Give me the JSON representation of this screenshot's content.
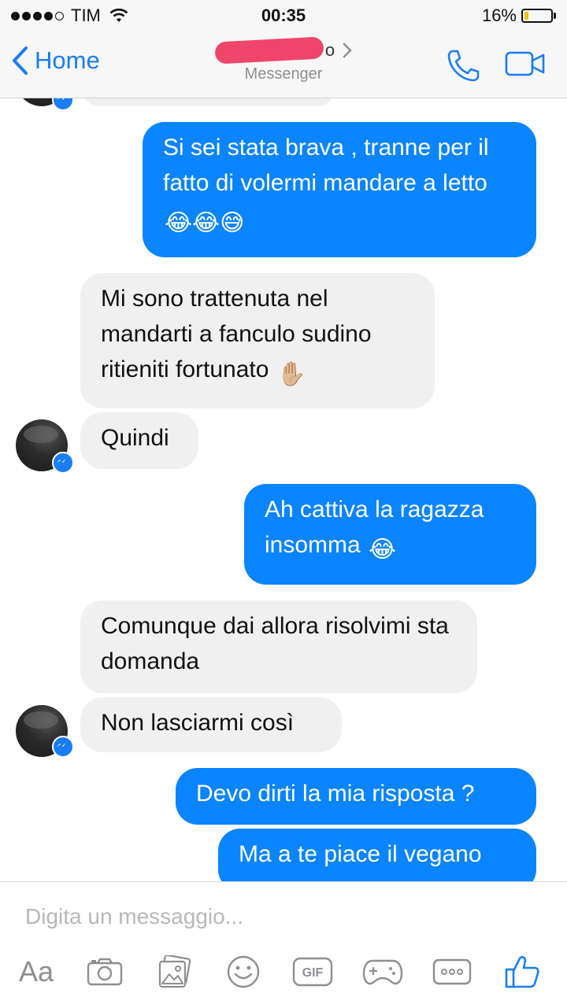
{
  "status_bar": {
    "carrier": "TIM",
    "time": "00:35",
    "battery_percent_text": "16%",
    "battery_level": 0.16
  },
  "nav": {
    "back_label": "Home",
    "contact_name_visible": "o",
    "subtitle": "Messenger"
  },
  "messages": [
    {
      "direction": "out",
      "text": "Si sei stata brava , tranne per il fatto di volermi mandare a letto",
      "emoji": "😂😂😅"
    },
    {
      "direction": "in",
      "text": "Mi sono trattenuta nel mandarti a fanculo sudino ritieniti fortunato",
      "emoji": "✋🏼"
    },
    {
      "direction": "in",
      "text": "Quindi",
      "emoji": ""
    },
    {
      "direction": "out",
      "text": "Ah cattiva la ragazza insomma",
      "emoji": "😂"
    },
    {
      "direction": "in",
      "text": "Comunque dai allora risolvimi sta domanda",
      "emoji": ""
    },
    {
      "direction": "in",
      "text": "Non lasciarmi così",
      "emoji": ""
    },
    {
      "direction": "out",
      "text": "Devo dirti la mia risposta ?",
      "emoji": ""
    },
    {
      "direction": "out",
      "text": "Ma a te piace il vegano",
      "emoji": ""
    }
  ],
  "composer": {
    "placeholder": "Digita un messaggio...",
    "aa_label": "Aa",
    "gif_label": "GIF",
    "tools": [
      "text-format-icon",
      "camera-icon",
      "gallery-icon",
      "emoji-icon",
      "gif-icon",
      "game-icon",
      "more-icon",
      "like-icon"
    ]
  },
  "colors": {
    "accent": "#1a7df5",
    "outgoing_bubble": "#0a84ff",
    "incoming_bubble": "#f1f0f0",
    "redaction": "#f0456a",
    "battery": "#f4c400"
  }
}
